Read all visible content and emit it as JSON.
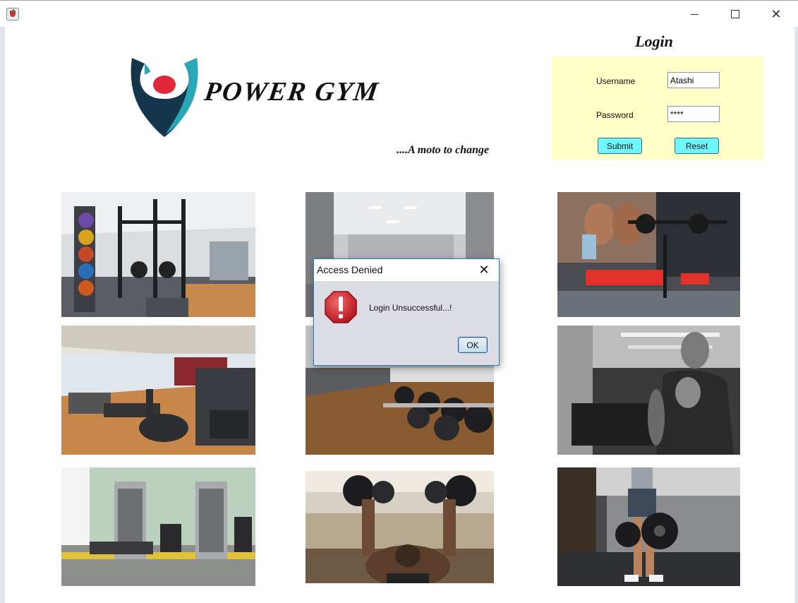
{
  "window": {
    "app_icon": "java-cup-icon",
    "controls": {
      "minimize": "minimize-icon",
      "maximize": "maximize-icon",
      "close": "close-icon"
    }
  },
  "header": {
    "brand": "POWER GYM",
    "tagline": "....A moto to change"
  },
  "login": {
    "title": "Login",
    "username_label": "Username",
    "username_value": "Atashi",
    "password_label": "Password",
    "password_value": "****",
    "submit_label": "Submit",
    "reset_label": "Reset"
  },
  "gallery": {
    "photos": [
      "gym-equipment-rack-photo",
      "gym-hall-photo",
      "arm-wrestling-photo",
      "cardio-machines-photo",
      "dumbbell-rack-photo",
      "treadmill-runner-photo",
      "weight-machines-photo",
      "dumbbell-press-photo",
      "weight-plate-carry-photo"
    ]
  },
  "dialog": {
    "title": "Access Denied",
    "message": "Login Unsuccessful...!",
    "ok_label": "OK",
    "icon": "error-icon"
  },
  "colors": {
    "login_panel": "#ffffc8",
    "button_cyan": "#6ff7ff",
    "logo_dark": "#15364a",
    "logo_teal": "#2aa7b7",
    "logo_red": "#e0283a",
    "dialog_border": "#2b7bc2"
  }
}
